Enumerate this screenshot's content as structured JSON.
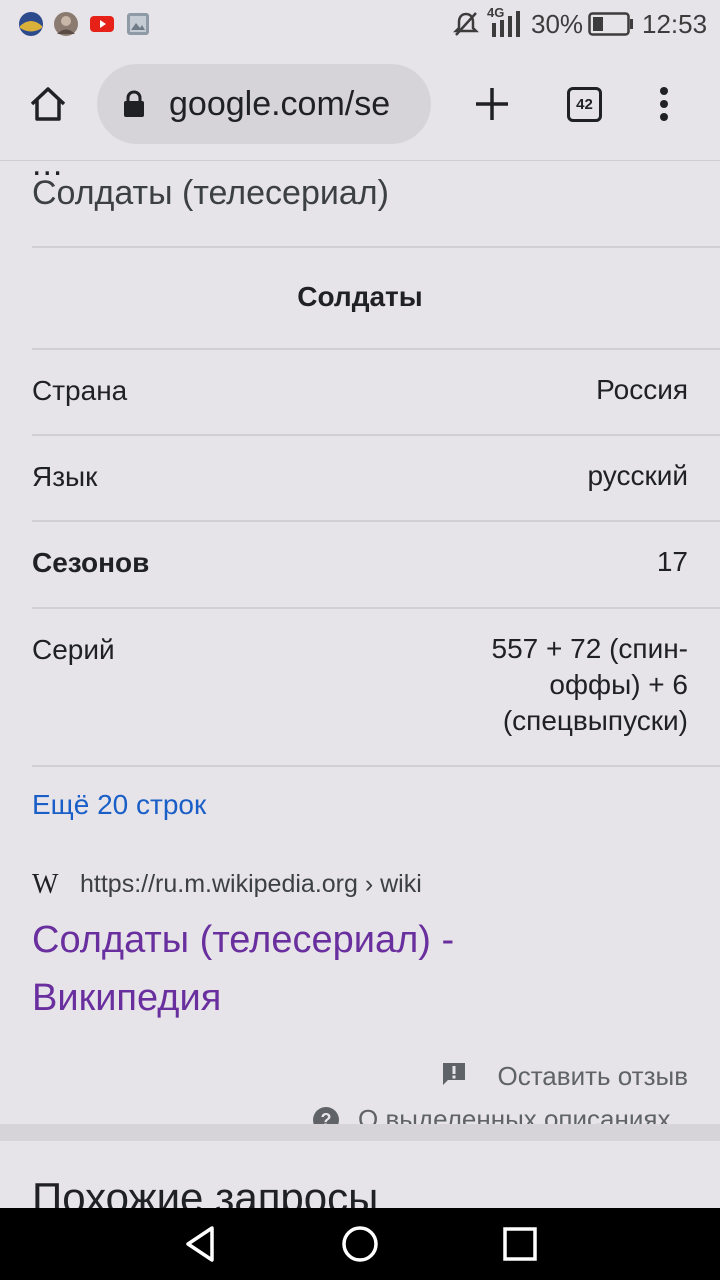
{
  "status_bar": {
    "battery_percent": "30%",
    "time": "12:53",
    "network": "4G",
    "icons": [
      "app-icon",
      "avatar-icon",
      "youtube-icon",
      "gallery-icon",
      "mute-icon",
      "signal-icon",
      "battery-icon"
    ]
  },
  "toolbar": {
    "url": "google.com/se",
    "tabs_count": "42",
    "icons": [
      "home-icon",
      "lock-icon",
      "plus-icon",
      "tabs-icon",
      "more-vert-icon"
    ]
  },
  "knowledge_panel": {
    "ellipsis": "...",
    "title": "Солдаты (телесериал)",
    "table_title": "Солдаты",
    "rows": [
      {
        "label": "Страна",
        "value": "Россия"
      },
      {
        "label": "Язык",
        "value": "русский"
      },
      {
        "label": "Сезонов",
        "value": "17"
      },
      {
        "label": "Серий",
        "value_lines": [
          "557 + 72 (спин-",
          "оффы) + 6",
          "(спецвыпуски)"
        ]
      }
    ],
    "more_link": "Ещё 20 строк"
  },
  "source": {
    "icon_letter": "W",
    "url": "https://ru.m.wikipedia.org › wiki",
    "title_lines": [
      "Солдаты (телесериал) -",
      "Википедия"
    ]
  },
  "feedback": {
    "label": "Оставить отзыв",
    "about_label": "О выделенных описаниях"
  },
  "related": {
    "heading": "Похожие запросы"
  },
  "nav_bar": {
    "icons": [
      "back-icon",
      "home-nav-icon",
      "recents-icon"
    ]
  },
  "colors": {
    "link_blue": "#1a5fc7",
    "visited_purple": "#6a2f9e",
    "background": "#e6e4e9"
  }
}
